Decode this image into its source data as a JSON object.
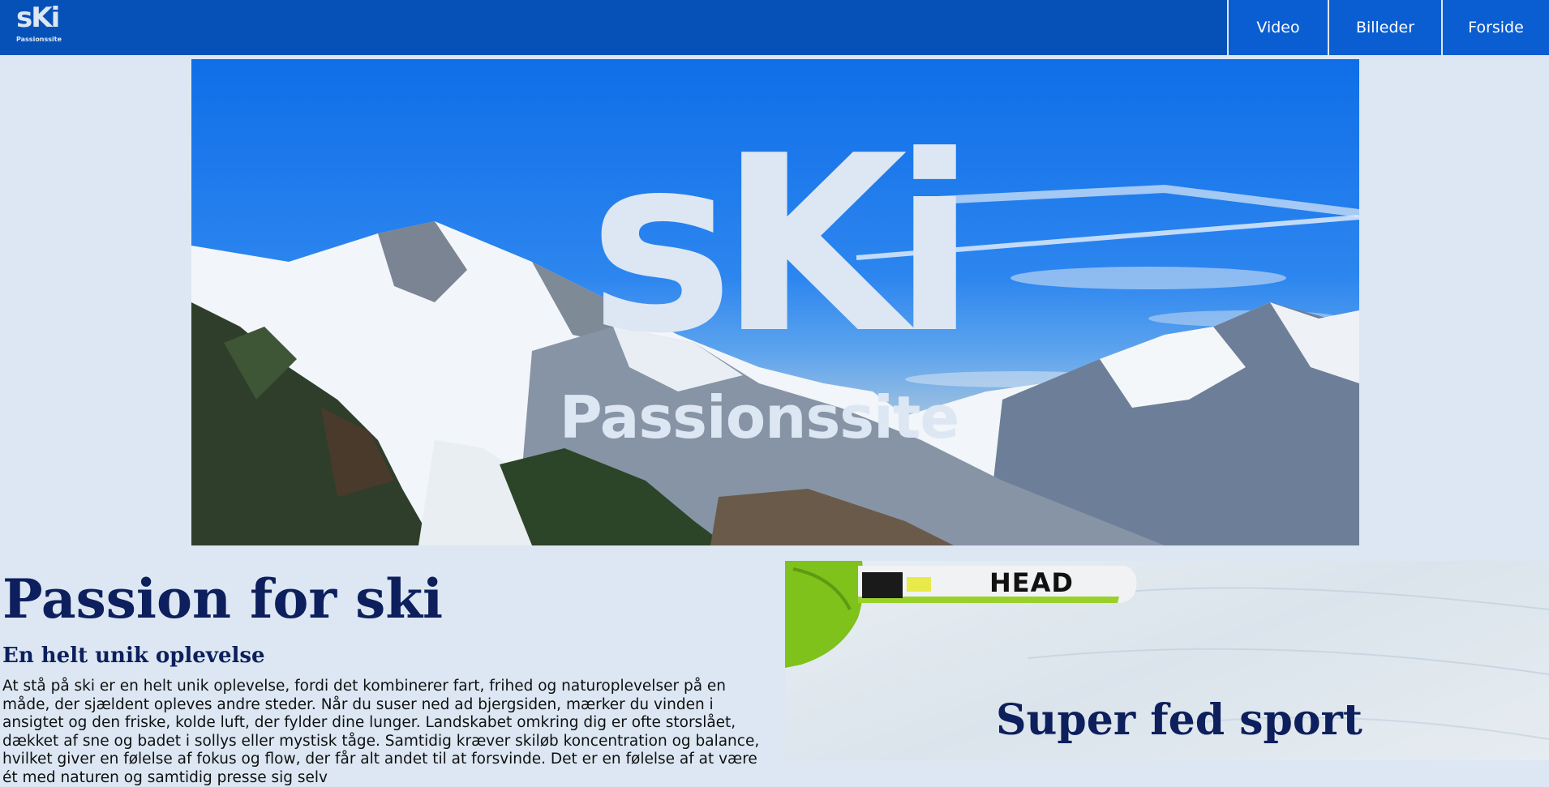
{
  "header": {
    "logo_text": "sKi",
    "logo_subtext": "Passionssite",
    "nav": [
      {
        "label": "Video"
      },
      {
        "label": "Billeder"
      },
      {
        "label": "Forside"
      }
    ]
  },
  "hero": {
    "title": "sKi",
    "subtitle": "Passionssite"
  },
  "main": {
    "title": "Passion for ski",
    "subtitle": "En helt unik oplevelse",
    "body": "At stå på ski er en helt unik oplevelse, fordi det kombinerer fart, frihed og naturoplevelser på en måde, der sjældent opleves andre steder. Når du suser ned ad bjergsiden, mærker du vinden i ansigtet og den friske, kolde luft, der fylder dine lunger. Landskabet omkring dig er ofte storslået, dækket af sne og badet i sollys eller mystisk tåge. Samtidig kræver skiløb koncentration og balance, hvilket giver en følelse af fokus og flow, der får alt andet til at forsvinde. Det er en følelse af at være ét med naturen og samtidig presse sig selv"
  },
  "aside": {
    "ski_brand": "HEAD",
    "title": "Super fed sport"
  },
  "colors": {
    "header_bg": "#0651b8",
    "nav_bg": "#0a5ed2",
    "page_bg": "#dce7f3",
    "heading": "#0d1f5c"
  }
}
